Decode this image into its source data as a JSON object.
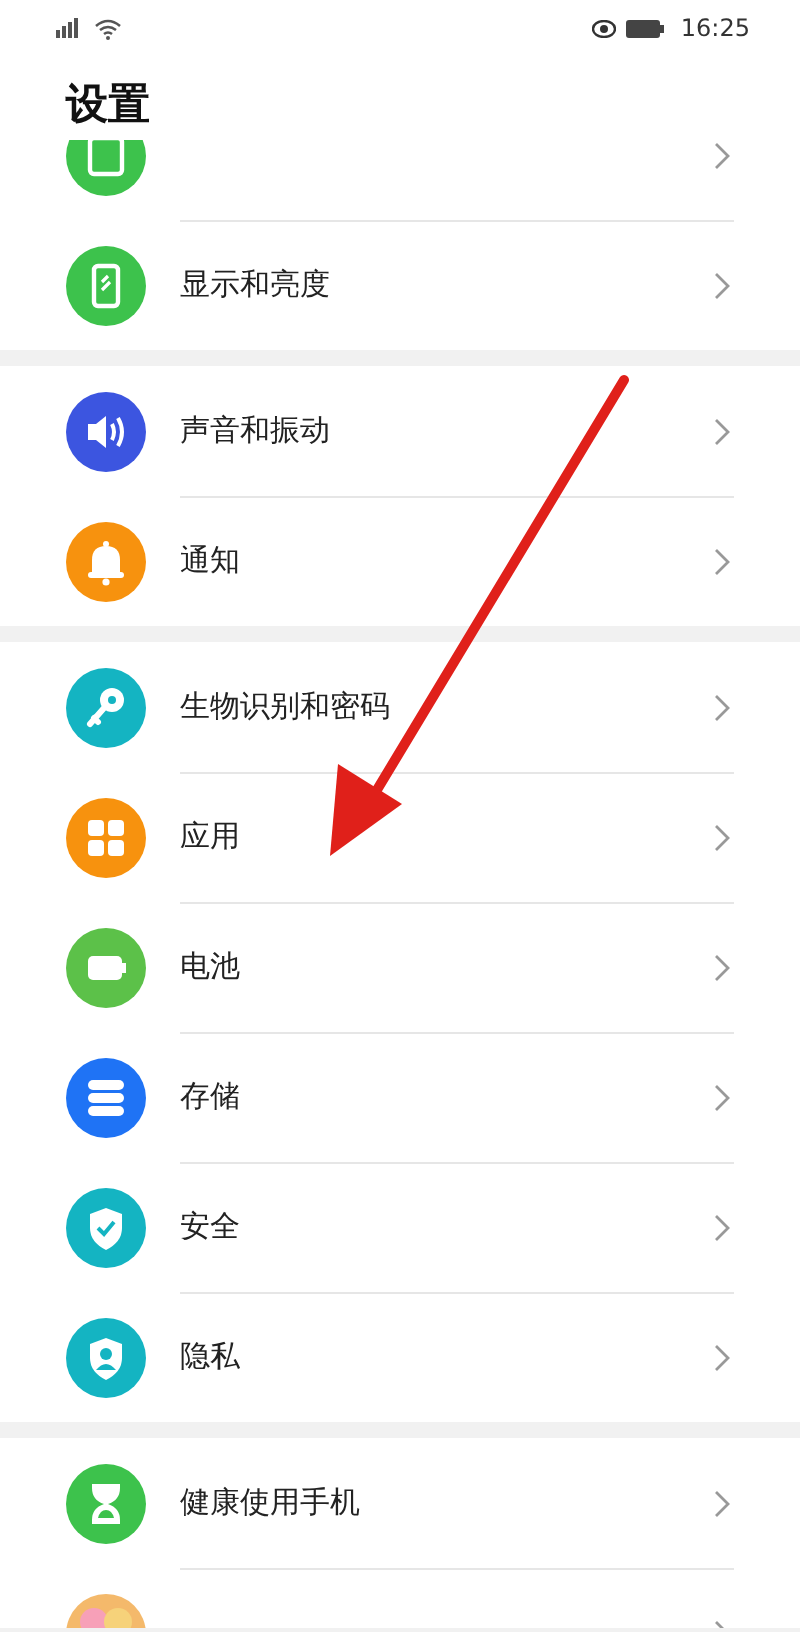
{
  "status_bar": {
    "time": "16:25"
  },
  "title": "设置",
  "groups": [
    {
      "rows": [
        {
          "kind": "desktop",
          "color": "#3dc24c",
          "cut_top": true
        },
        {
          "kind": "display",
          "color": "#3dc24c",
          "label": "显示和亮度"
        }
      ]
    },
    {
      "rows": [
        {
          "kind": "sound",
          "color": "#3c55e0",
          "label": "声音和振动"
        },
        {
          "kind": "bell",
          "color": "#f7920e",
          "label": "通知"
        }
      ]
    },
    {
      "rows": [
        {
          "kind": "key",
          "color": "#14b4c2",
          "label": "生物识别和密码"
        },
        {
          "kind": "apps",
          "color": "#f7920e",
          "label": "应用"
        },
        {
          "kind": "battery",
          "color": "#5cc149",
          "label": "电池"
        },
        {
          "kind": "storage",
          "color": "#1f73f5",
          "label": "存储"
        },
        {
          "kind": "shield",
          "color": "#14b4c2",
          "label": "安全"
        },
        {
          "kind": "privacy",
          "color": "#14b4c2",
          "label": "隐私"
        }
      ]
    },
    {
      "rows": [
        {
          "kind": "hourglass",
          "color": "#3dc24c",
          "label": "健康使用手机"
        },
        {
          "kind": "assistant",
          "color": "#f4b96b",
          "cut_bottom": true
        }
      ]
    }
  ]
}
